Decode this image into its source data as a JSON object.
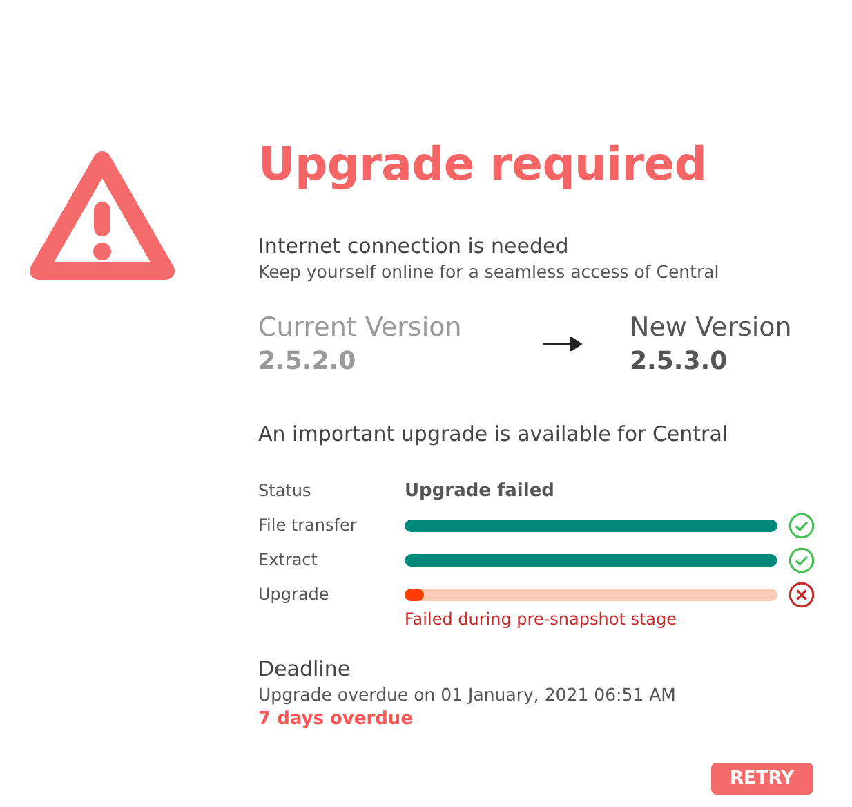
{
  "title": "Upgrade required",
  "notice": {
    "heading": "Internet connection is needed",
    "text": "Keep yourself online for a seamless access of Central"
  },
  "versions": {
    "current_label": "Current Version",
    "current": "2.5.2.0",
    "new_label": "New Version",
    "new": "2.5.3.0"
  },
  "message": "An important upgrade is available for Central",
  "status": {
    "label": "Status",
    "value": "Upgrade failed"
  },
  "steps": [
    {
      "label": "File transfer",
      "level": 1,
      "kind": "done"
    },
    {
      "label": "Extract",
      "level": 1,
      "kind": "done"
    },
    {
      "label": "Upgrade",
      "level": 0.05,
      "kind": "failed",
      "error": "Failed during pre-snapshot stage"
    }
  ],
  "deadline": {
    "heading": "Deadline",
    "text": "Upgrade overdue on 01 January, 2021 06:51 AM",
    "overdue": "7 days overdue"
  },
  "button": "RETRY"
}
